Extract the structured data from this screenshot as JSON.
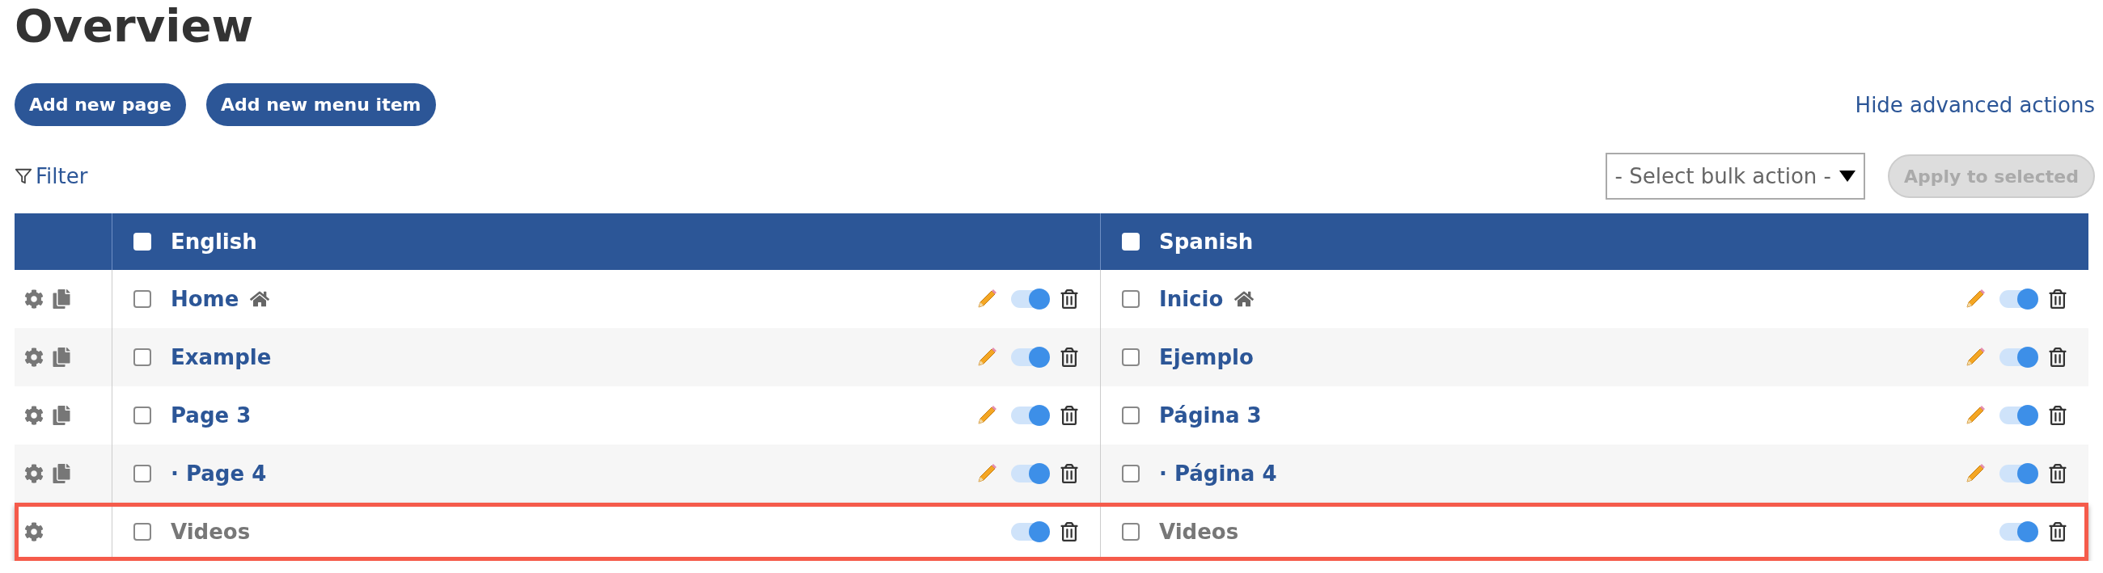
{
  "title": "Overview",
  "actions": [
    {
      "label": "Add new page"
    },
    {
      "label": "Add new menu item"
    }
  ],
  "advanced_link": "Hide advanced actions",
  "filter": "Filter",
  "bulk_select": {
    "value": "- Select bulk action -"
  },
  "apply_button": {
    "label": "Apply to selected",
    "disabled": true
  },
  "columns": [
    {
      "label": "English",
      "checked": false
    },
    {
      "label": "Spanish",
      "checked": false
    }
  ],
  "rows": [
    {
      "highlighted": false,
      "duplicable": true,
      "cells": [
        {
          "title": "Home",
          "link": true,
          "home": true,
          "editable": true,
          "published": true,
          "checked": false
        },
        {
          "title": "Inicio",
          "link": true,
          "home": true,
          "editable": true,
          "published": true,
          "checked": false
        }
      ]
    },
    {
      "highlighted": false,
      "duplicable": true,
      "cells": [
        {
          "title": "Example",
          "link": true,
          "home": false,
          "editable": true,
          "published": true,
          "checked": false
        },
        {
          "title": "Ejemplo",
          "link": true,
          "home": false,
          "editable": true,
          "published": true,
          "checked": false
        }
      ]
    },
    {
      "highlighted": false,
      "duplicable": true,
      "cells": [
        {
          "title": "Page 3",
          "link": true,
          "home": false,
          "editable": true,
          "published": true,
          "checked": false
        },
        {
          "title": "Página 3",
          "link": true,
          "home": false,
          "editable": true,
          "published": true,
          "checked": false
        }
      ]
    },
    {
      "highlighted": false,
      "duplicable": true,
      "cells": [
        {
          "title": "· Page 4",
          "link": true,
          "home": false,
          "editable": true,
          "published": true,
          "checked": false
        },
        {
          "title": "· Página 4",
          "link": true,
          "home": false,
          "editable": true,
          "published": true,
          "checked": false
        }
      ]
    },
    {
      "highlighted": true,
      "duplicable": false,
      "cells": [
        {
          "title": "Videos",
          "link": false,
          "home": false,
          "editable": false,
          "published": true,
          "checked": false
        },
        {
          "title": "Videos",
          "link": false,
          "home": false,
          "editable": false,
          "published": true,
          "checked": false
        }
      ]
    }
  ]
}
